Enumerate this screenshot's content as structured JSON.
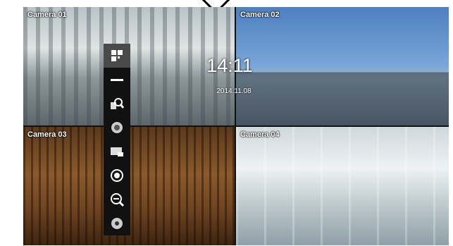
{
  "cameras": [
    {
      "label": "Camera 01"
    },
    {
      "label": "Camera 02"
    },
    {
      "label": "Camera 03"
    },
    {
      "label": "Camera 04"
    }
  ],
  "overlay": {
    "time": "14:11",
    "date": "2014.11.08"
  },
  "toolbar": {
    "buttons": [
      {
        "icon": "layout-icon",
        "active": true
      },
      {
        "icon": "sequence-icon"
      },
      {
        "icon": "search-icon"
      },
      {
        "icon": "ptz-icon"
      },
      {
        "icon": "backup-icon"
      },
      {
        "icon": "record-icon"
      },
      {
        "icon": "zoom-icon"
      },
      {
        "icon": "settings-icon"
      }
    ]
  }
}
